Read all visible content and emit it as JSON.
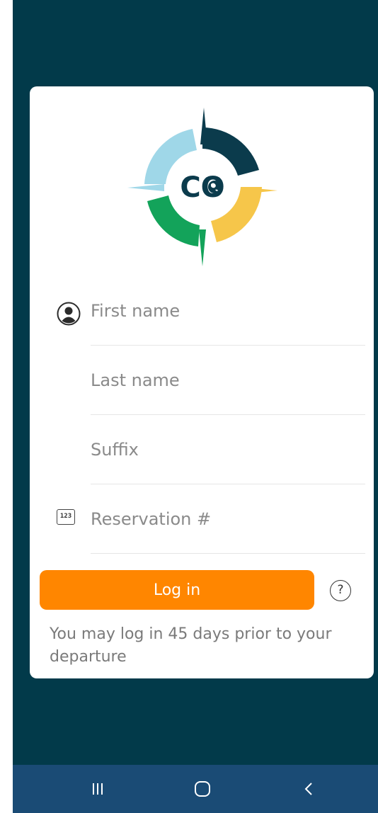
{
  "colors": {
    "background": "#023a4a",
    "card": "#ffffff",
    "accent": "#ff8600",
    "nav_bar": "#1a4b75",
    "logo_dark": "#0b3b4c",
    "logo_light_blue": "#9fd7e8",
    "logo_yellow": "#f6c64a",
    "logo_green": "#13a35a"
  },
  "logo": {
    "text": "CO",
    "icon": "compass-globe-logo"
  },
  "form": {
    "first_name": {
      "placeholder": "First name",
      "value": "",
      "icon": "person-icon"
    },
    "last_name": {
      "placeholder": "Last name",
      "value": ""
    },
    "suffix": {
      "placeholder": "Suffix",
      "value": ""
    },
    "reservation": {
      "placeholder": "Reservation #",
      "value": "",
      "icon": "number-pad-icon",
      "icon_text": "123"
    }
  },
  "login": {
    "label": "Log in",
    "help_icon": "help-icon",
    "help_text": "?"
  },
  "note": "You may log in 45 days prior to your departure",
  "navbar": {
    "recent": "recent-apps-icon",
    "home": "home-icon",
    "back": "back-icon"
  }
}
